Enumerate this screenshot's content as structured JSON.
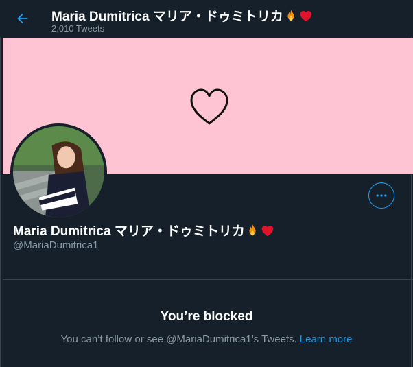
{
  "header": {
    "display_name": "Maria Dumitrica マリア・ドゥミトリカ",
    "tweets_count": "2,010 Tweets"
  },
  "profile": {
    "display_name": "Maria Dumitrica マリア・ドゥミトリカ",
    "handle": "@MariaDumitrica1",
    "emojis": [
      "fire-emoji",
      "red-heart-emoji"
    ]
  },
  "blocked": {
    "title": "You’re blocked",
    "message": "You can’t follow or see @MariaDumitrica1’s Tweets.",
    "learn_more": "Learn more"
  },
  "colors": {
    "background": "#15202b",
    "banner": "#ffc4d4",
    "accent": "#1da1f2",
    "secondary_text": "#8899a6",
    "border": "#38444d"
  },
  "icons": {
    "back": "arrow-left-icon",
    "more": "more-horizontal-icon",
    "banner": "heart-outline-icon"
  }
}
